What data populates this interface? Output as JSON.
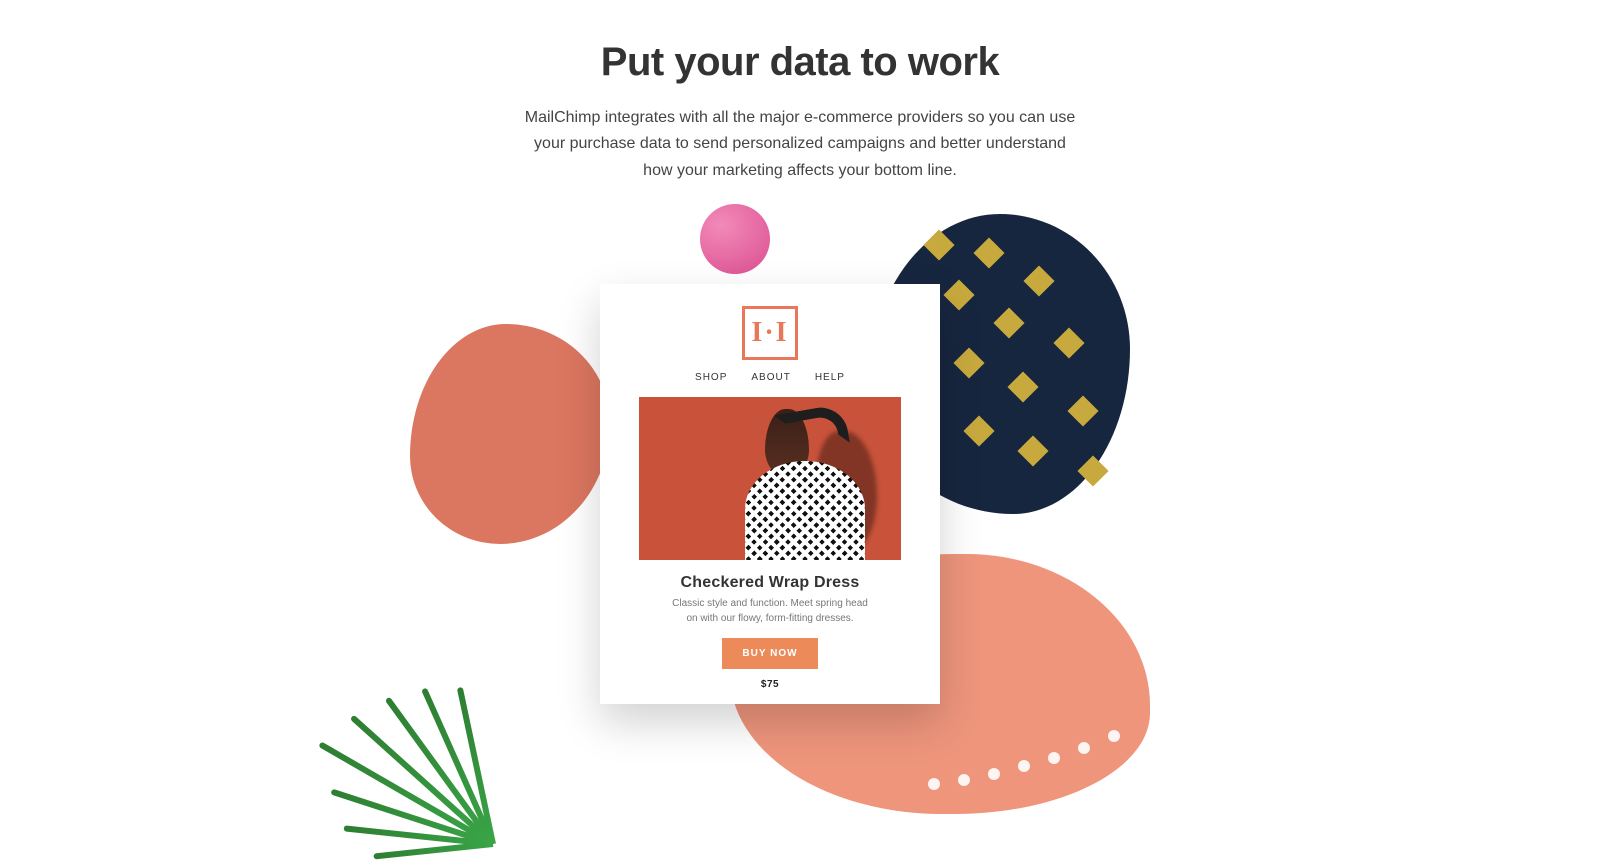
{
  "hero": {
    "headline": "Put your data to work",
    "subcopy": "MailChimp integrates with all the major e-commerce providers so you can use your purchase data to send personalized campaigns and better understand how your marketing affects your bottom line."
  },
  "card": {
    "logo_text": "I·I",
    "nav": [
      "SHOP",
      "ABOUT",
      "HELP"
    ],
    "product": {
      "name": "Checkered Wrap Dress",
      "desc": "Classic style and function. Meet spring head on with our flowy, form-fitting dresses.",
      "cta": "BUY NOW",
      "price": "$75"
    }
  }
}
